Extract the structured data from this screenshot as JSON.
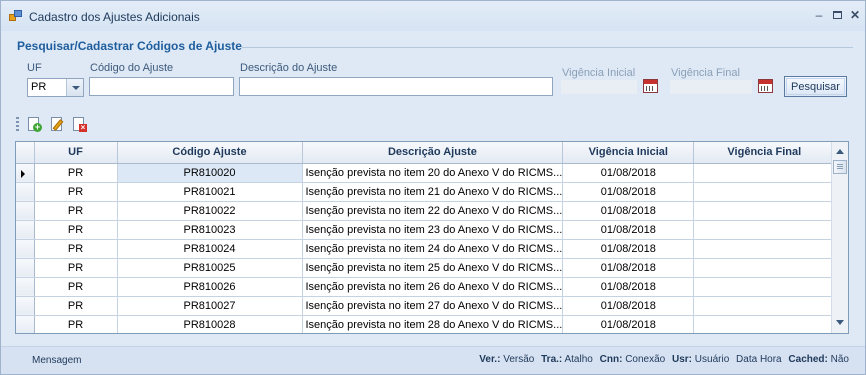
{
  "window": {
    "title": "Cadastro dos Ajustes Adicionais"
  },
  "form": {
    "group_title": "Pesquisar/Cadastrar Códigos de Ajuste",
    "uf_label": "UF",
    "uf_value": "PR",
    "codigo_label": "Código do Ajuste",
    "codigo_value": "",
    "descricao_label": "Descrição do Ajuste",
    "descricao_value": "",
    "vigencia_inicial_label": "Vigência Inicial",
    "vigencia_inicial_value": "",
    "vigencia_final_label": "Vigência Final",
    "vigencia_final_value": "",
    "search_button": "Pesquisar"
  },
  "toolbar": {
    "icons": [
      "add-document-icon",
      "edit-document-icon",
      "delete-document-icon"
    ]
  },
  "grid": {
    "columns": [
      "UF",
      "Código Ajuste",
      "Descrição Ajuste",
      "Vigência Inicial",
      "Vigência Final"
    ],
    "rows": [
      {
        "uf": "PR",
        "codigo": "PR810020",
        "descricao": "Isenção prevista no item 20 do Anexo V do RICMS...",
        "vig_ini": "01/08/2018",
        "vig_fim": ""
      },
      {
        "uf": "PR",
        "codigo": "PR810021",
        "descricao": "Isenção prevista no item 21 do Anexo V do RICMS...",
        "vig_ini": "01/08/2018",
        "vig_fim": ""
      },
      {
        "uf": "PR",
        "codigo": "PR810022",
        "descricao": "Isenção prevista no item 22 do Anexo V do RICMS...",
        "vig_ini": "01/08/2018",
        "vig_fim": ""
      },
      {
        "uf": "PR",
        "codigo": "PR810023",
        "descricao": "Isenção prevista no item 23 do Anexo V do RICMS...",
        "vig_ini": "01/08/2018",
        "vig_fim": ""
      },
      {
        "uf": "PR",
        "codigo": "PR810024",
        "descricao": "Isenção prevista no item 24 do Anexo V do RICMS...",
        "vig_ini": "01/08/2018",
        "vig_fim": ""
      },
      {
        "uf": "PR",
        "codigo": "PR810025",
        "descricao": "Isenção prevista no item 25 do Anexo V do RICMS...",
        "vig_ini": "01/08/2018",
        "vig_fim": ""
      },
      {
        "uf": "PR",
        "codigo": "PR810026",
        "descricao": "Isenção prevista no item 26 do Anexo V do RICMS...",
        "vig_ini": "01/08/2018",
        "vig_fim": ""
      },
      {
        "uf": "PR",
        "codigo": "PR810027",
        "descricao": "Isenção prevista no item 27 do Anexo V do RICMS...",
        "vig_ini": "01/08/2018",
        "vig_fim": ""
      },
      {
        "uf": "PR",
        "codigo": "PR810028",
        "descricao": "Isenção prevista no item 28 do Anexo V do RICMS...",
        "vig_ini": "01/08/2018",
        "vig_fim": ""
      }
    ]
  },
  "statusbar": {
    "message": "Mensagem",
    "ver_label": "Ver.:",
    "ver_value": "Versão",
    "tra_label": "Tra.:",
    "tra_value": "Atalho",
    "cnn_label": "Cnn:",
    "cnn_value": "Conexão",
    "usr_label": "Usr:",
    "usr_value": "Usuário",
    "data_hora": "Data Hora",
    "cached_label": "Cached:",
    "cached_value": "Não"
  },
  "colors": {
    "window_bg": "#dfe9f5",
    "group_title": "#1e5e9e",
    "selected_cell": "#dde8f6"
  }
}
